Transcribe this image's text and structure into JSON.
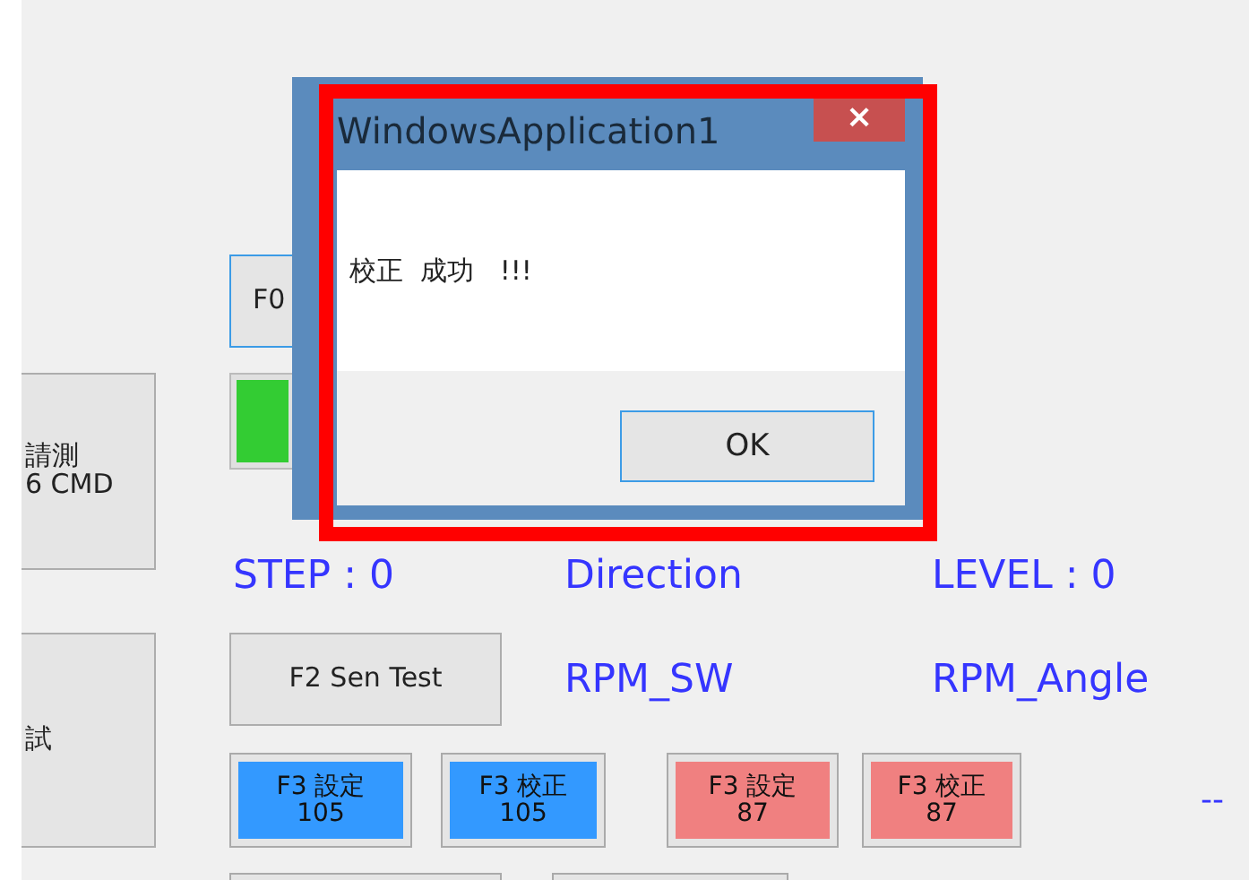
{
  "main_form": {
    "side_buttons": [
      {
        "lines": [
          "請測",
          "6 CMD"
        ]
      },
      {
        "lines": [
          "試"
        ]
      }
    ],
    "f0_button": "F0",
    "indicator": {
      "on": true
    },
    "status_labels": [
      "STEP : 0",
      "Direction",
      "LEVEL : 0"
    ],
    "f2_button": "F2 Sen Test",
    "rpm_labels": [
      "RPM_SW",
      "RPM_Angle"
    ],
    "f3_buttons": [
      {
        "label": "F3 設定",
        "value": "105",
        "color": "#3399ff"
      },
      {
        "label": "F3 校正",
        "value": "105",
        "color": "#3399ff"
      },
      {
        "label": "F3 設定",
        "value": "87",
        "color": "#f08080"
      },
      {
        "label": "F3 校正",
        "value": "87",
        "color": "#f08080"
      }
    ],
    "dash_text": "--"
  },
  "dialog": {
    "title": "WindowsApplication1",
    "close": "×",
    "message": "校正  成功   !!!",
    "button": "OK"
  }
}
